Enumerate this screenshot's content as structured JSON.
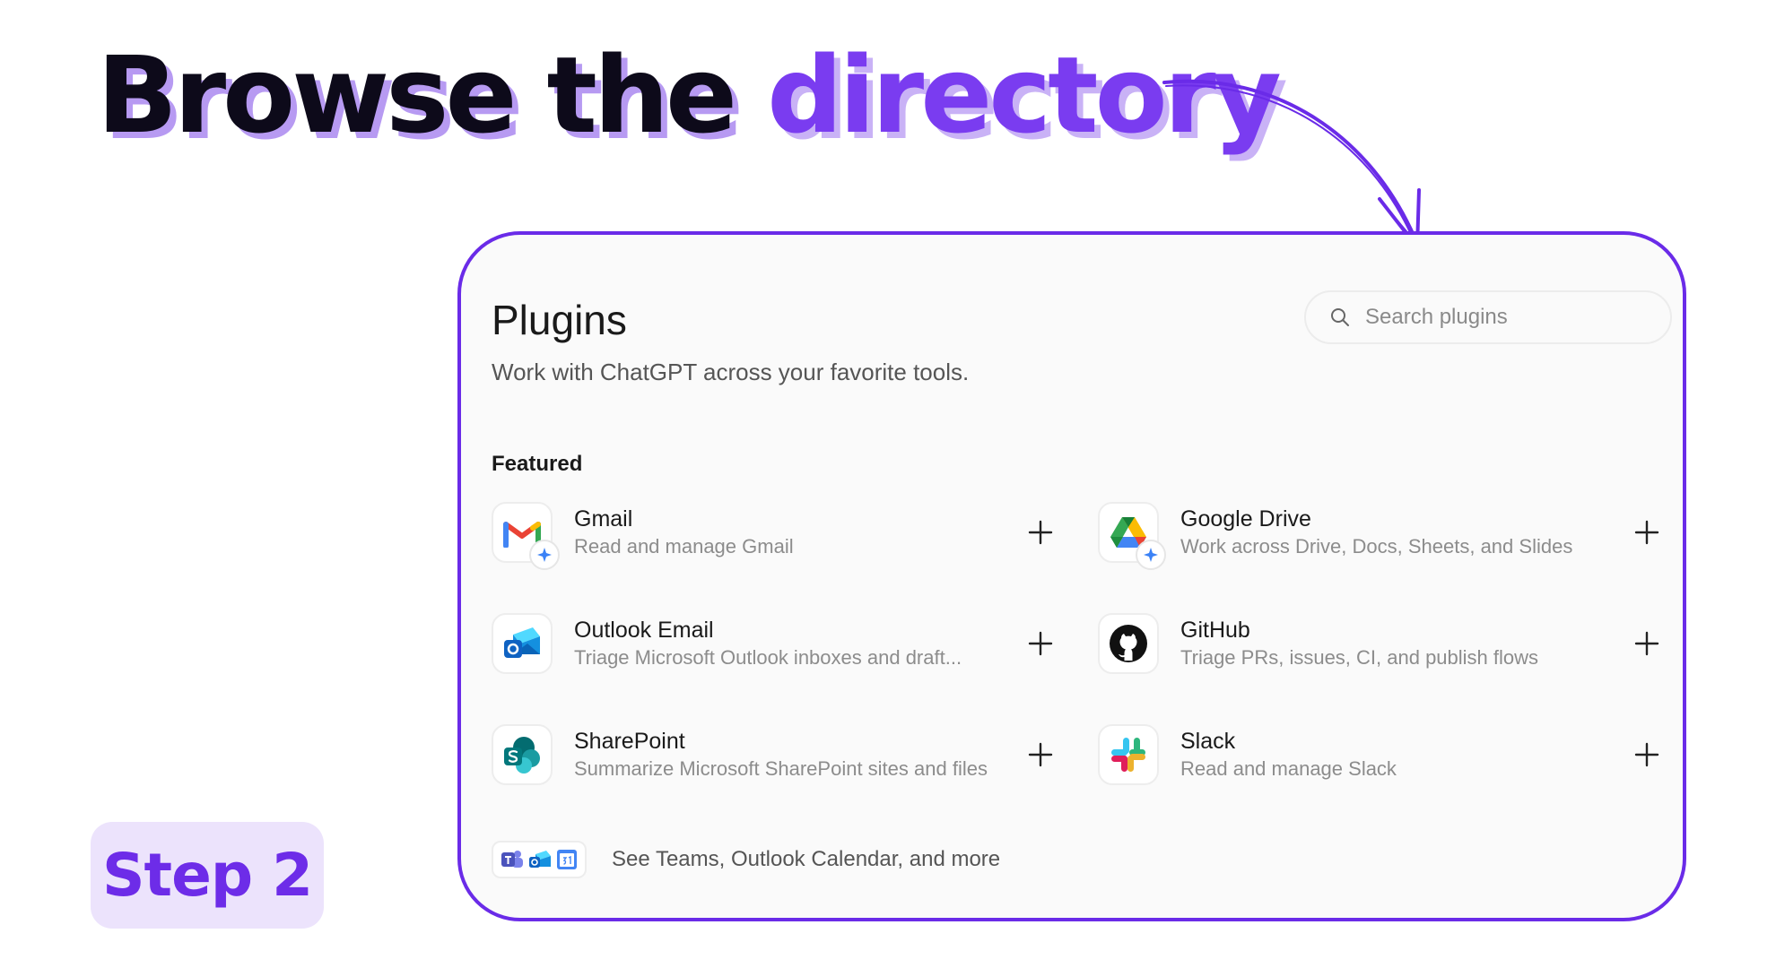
{
  "headline": {
    "part_a": "Browse the ",
    "part_b": "directory"
  },
  "step_badge": "Step 2",
  "page": {
    "title": "Plugins",
    "subtitle": "Work with ChatGPT across your favorite tools.",
    "search": {
      "placeholder": "Search plugins",
      "value": ""
    },
    "section_label": "Featured",
    "plugins": [
      {
        "name": "Gmail",
        "description": "Read and manage Gmail",
        "icon": "gmail-icon"
      },
      {
        "name": "Google Drive",
        "description": "Work across Drive, Docs, Sheets, and Slides",
        "icon": "google-drive-icon"
      },
      {
        "name": "Outlook Email",
        "description": "Triage Microsoft Outlook inboxes and draft...",
        "icon": "outlook-icon"
      },
      {
        "name": "GitHub",
        "description": "Triage PRs, issues, CI, and publish flows",
        "icon": "github-icon"
      },
      {
        "name": "SharePoint",
        "description": "Summarize Microsoft SharePoint sites and files",
        "icon": "sharepoint-icon"
      },
      {
        "name": "Slack",
        "description": "Read and manage Slack",
        "icon": "slack-icon"
      }
    ],
    "more_link": "See Teams, Outlook Calendar, and more"
  },
  "colors": {
    "accent": "#7a3cf0",
    "accent_shadow": "#b79af2",
    "badge_bg": "#ece3fc",
    "card_border": "#6a2be8"
  }
}
